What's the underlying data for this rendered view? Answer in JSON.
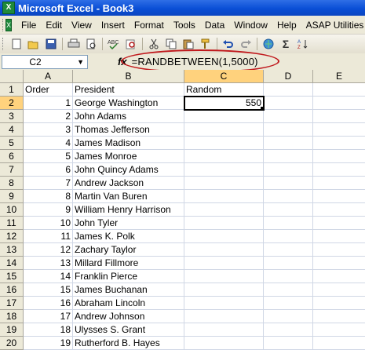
{
  "window": {
    "title": "Microsoft Excel - Book3",
    "app_icon": "excel-icon"
  },
  "menu": {
    "items": [
      "File",
      "Edit",
      "View",
      "Insert",
      "Format",
      "Tools",
      "Data",
      "Window",
      "Help",
      "ASAP Utilities"
    ]
  },
  "toolbar": {
    "buttons": [
      "new-icon",
      "open-icon",
      "save-icon",
      "print-icon",
      "print-preview-icon",
      "spelling-icon",
      "research-icon",
      "cut-icon",
      "copy-icon",
      "paste-icon",
      "format-painter-icon",
      "undo-icon",
      "redo-icon",
      "hyperlink-icon",
      "autosum-icon",
      "sort-icon"
    ],
    "sigma": "Σ"
  },
  "formula_bar": {
    "name_box": "C2",
    "fx": "fx",
    "formula": "=RANDBETWEEN(1,5000)"
  },
  "sheet": {
    "columns": [
      "A",
      "B",
      "C",
      "D",
      "E"
    ],
    "active_column": "C",
    "active_row": 2,
    "rows": [
      {
        "n": "1",
        "a": "Order",
        "b": "President",
        "c": "Random"
      },
      {
        "n": "2",
        "a": "1",
        "b": "George Washington",
        "c": "550"
      },
      {
        "n": "3",
        "a": "2",
        "b": "John Adams",
        "c": ""
      },
      {
        "n": "4",
        "a": "3",
        "b": "Thomas Jefferson",
        "c": ""
      },
      {
        "n": "5",
        "a": "4",
        "b": "James Madison",
        "c": ""
      },
      {
        "n": "6",
        "a": "5",
        "b": "James Monroe",
        "c": ""
      },
      {
        "n": "7",
        "a": "6",
        "b": "John Quincy Adams",
        "c": ""
      },
      {
        "n": "8",
        "a": "7",
        "b": "Andrew Jackson",
        "c": ""
      },
      {
        "n": "9",
        "a": "8",
        "b": "Martin Van Buren",
        "c": ""
      },
      {
        "n": "10",
        "a": "9",
        "b": "William Henry Harrison",
        "c": ""
      },
      {
        "n": "11",
        "a": "10",
        "b": "John Tyler",
        "c": ""
      },
      {
        "n": "12",
        "a": "11",
        "b": "James K. Polk",
        "c": ""
      },
      {
        "n": "13",
        "a": "12",
        "b": "Zachary Taylor",
        "c": ""
      },
      {
        "n": "14",
        "a": "13",
        "b": "Millard Fillmore",
        "c": ""
      },
      {
        "n": "15",
        "a": "14",
        "b": "Franklin Pierce",
        "c": ""
      },
      {
        "n": "16",
        "a": "15",
        "b": "James Buchanan",
        "c": ""
      },
      {
        "n": "17",
        "a": "16",
        "b": "Abraham Lincoln",
        "c": ""
      },
      {
        "n": "18",
        "a": "17",
        "b": "Andrew Johnson",
        "c": ""
      },
      {
        "n": "19",
        "a": "18",
        "b": "Ulysses S. Grant",
        "c": ""
      },
      {
        "n": "20",
        "a": "19",
        "b": "Rutherford B. Hayes",
        "c": ""
      }
    ]
  },
  "colors": {
    "title_bar": "#0a4fd6",
    "highlight_oval": "#c0181c",
    "active_header": "#ffd27d"
  }
}
